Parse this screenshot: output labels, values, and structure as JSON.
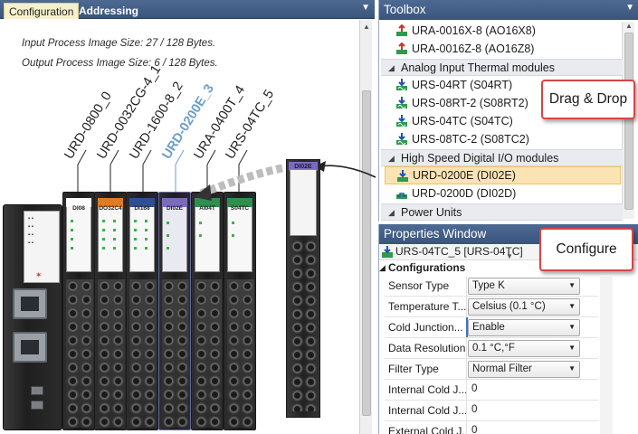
{
  "config_panel": {
    "tabs": [
      "Configuration",
      "Addressing"
    ],
    "input_image_size": "Input Process Image Size: 27 / 128 Bytes.",
    "output_image_size": "Output Process Image Size: 6 / 128 Bytes."
  },
  "modules": [
    {
      "label": "URD-0800_0",
      "face": "DI08",
      "color": "#ffffff"
    },
    {
      "label": "URD-0032CG-4_1",
      "face": "DO32C4",
      "color": "#e07b22"
    },
    {
      "label": "URD-1600-8_2",
      "face": "DI168",
      "color": "#2f4f94"
    },
    {
      "label": "URD-0200E_3",
      "face": "DI02E",
      "color": "#7b6bbf",
      "highlighted": true
    },
    {
      "label": "URA-0400T_4",
      "face": "AI04T",
      "color": "#2f8f4f"
    },
    {
      "label": "URS-04TC_5",
      "face": "S04TC",
      "color": "#2f8f4f"
    }
  ],
  "flyout_module": {
    "face": "DI02E"
  },
  "toolbox": {
    "title": "Toolbox",
    "items": [
      {
        "type": "item",
        "label": "URA-0016X-8 (AO16X8)",
        "icon": "analog-output-icon"
      },
      {
        "type": "item",
        "label": "URA-0016Z-8 (AO16Z8)",
        "icon": "analog-output-icon"
      },
      {
        "type": "category",
        "label": "Analog Input Thermal modules"
      },
      {
        "type": "item",
        "label": "URS-04RT (S04RT)",
        "icon": "analog-input-icon"
      },
      {
        "type": "item",
        "label": "URS-08RT-2 (S08RT2)",
        "icon": "analog-input-icon"
      },
      {
        "type": "item",
        "label": "URS-04TC (S04TC)",
        "icon": "analog-input-icon"
      },
      {
        "type": "item",
        "label": "URS-08TC-2 (S08TC2)",
        "icon": "analog-input-icon"
      },
      {
        "type": "category",
        "label": "High Speed Digital I/O modules"
      },
      {
        "type": "item",
        "label": "URD-0200E (DI02E)",
        "icon": "digital-input-icon",
        "selected": true
      },
      {
        "type": "item",
        "label": "URD-0200D (DI02D)",
        "icon": "digital-output-icon"
      },
      {
        "type": "category",
        "label": "Power Units"
      }
    ]
  },
  "properties": {
    "title": "Properties Window",
    "object": "URS-04TC_5 [URS-04TC]",
    "category": "Configurations",
    "rows": [
      {
        "name": "Sensor Type",
        "value": "Type K",
        "combo": true
      },
      {
        "name": "Temperature T...",
        "value": "Celsius (0.1 °C)",
        "combo": true
      },
      {
        "name": "Cold Junction...",
        "value": "Enable",
        "combo": true,
        "focus": true
      },
      {
        "name": "Data Resolution",
        "value": "0.1 °C,°F",
        "combo": true
      },
      {
        "name": "Filter Type",
        "value": "Normal Filter",
        "combo": true
      },
      {
        "name": "Internal Cold J...",
        "value": "0",
        "combo": false
      },
      {
        "name": "Internal Cold J...",
        "value": "0",
        "combo": false
      },
      {
        "name": "External Cold J...",
        "value": "0",
        "combo": false
      }
    ]
  },
  "callouts": {
    "drag_drop": "Drag & Drop",
    "configure": "Configure"
  },
  "colors": {
    "header_blue": "#3f5b85",
    "selection": "#fbe3b3",
    "callout_border": "#d64545",
    "highlight_label": "#6c9ec8"
  }
}
